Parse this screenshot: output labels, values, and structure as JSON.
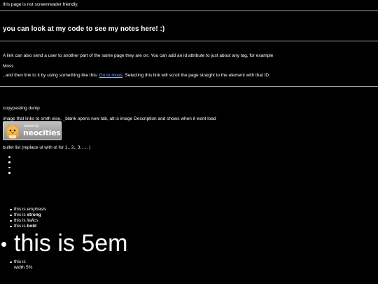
{
  "notice": "this page is not screenreader friendly.",
  "heading": "you can look at my code to see my notes here! :)",
  "link_paragraph": "A link can also send a user to another part of the same page they are on. You can add an id attribute to just about any tag, for example",
  "moss_label": "Moss",
  "then_paragraph": {
    "prefix": ", and then link to it by using something like this: ",
    "link_text": "Go to moss",
    "suffix": ". Selecting this link will scroll the page straight to the element with that ID."
  },
  "copypasting_dump": "copypasting dump",
  "image_description": "image that links to smth else, _blank opens new tab, alt is image Description and shows when it wont load",
  "badge": {
    "hosted": "hosted by",
    "brand": "neocities"
  },
  "bullet_list_title": "bullet list (replace ul with ol for 1., 2., 3., ... )",
  "styled_list": [
    {
      "prefix": "this is ",
      "styled": "emphasis",
      "style": "em"
    },
    {
      "prefix": "this is ",
      "styled": "strong",
      "style": "strong"
    },
    {
      "prefix": "this is ",
      "styled": "italics",
      "style": "i"
    },
    {
      "prefix": "this is ",
      "styled": "bold",
      "style": "b"
    }
  ],
  "big_text": "this is 5em",
  "width_item": "this is width 5%"
}
